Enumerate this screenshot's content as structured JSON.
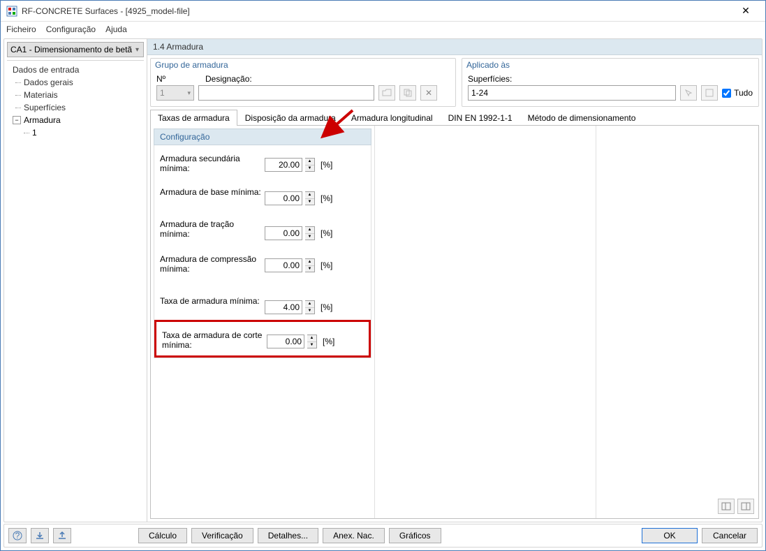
{
  "titlebar": {
    "title": "RF-CONCRETE Surfaces - [4925_model-file]"
  },
  "menu": {
    "file": "Ficheiro",
    "config": "Configuração",
    "help": "Ajuda"
  },
  "combo": "CA1 - Dimensionamento de betã",
  "tree": {
    "root": "Dados de entrada",
    "items": [
      "Dados gerais",
      "Materiais",
      "Superfícies"
    ],
    "parent": "Armadura",
    "sub": "1"
  },
  "section": "1.4 Armadura",
  "group1": {
    "title": "Grupo de armadura",
    "no": "Nº",
    "design": "Designação:",
    "no_val": "1",
    "design_val": ""
  },
  "group2": {
    "title": "Aplicado às",
    "surf": "Superfícies:",
    "surf_val": "1-24",
    "all": "Tudo"
  },
  "tabs": [
    "Taxas de armadura",
    "Disposição da armadura",
    "Armadura longitudinal",
    "DIN EN 1992-1-1",
    "Método de dimensionamento"
  ],
  "config": {
    "header": "Configuração",
    "rows": [
      {
        "label": "Armadura secundária mínima:",
        "value": "20.00",
        "unit": "[%]"
      },
      {
        "label": "Armadura de base mínima:",
        "value": "0.00",
        "unit": "[%]"
      },
      {
        "label": "Armadura de tração mínima:",
        "value": "0.00",
        "unit": "[%]"
      },
      {
        "label": "Armadura de compressão mínima:",
        "value": "0.00",
        "unit": "[%]"
      },
      {
        "label": "Taxa de armadura mínima:",
        "value": "4.00",
        "unit": "[%]"
      },
      {
        "label": "Taxa de armadura de corte mínima:",
        "value": "0.00",
        "unit": "[%]"
      }
    ]
  },
  "footer": {
    "calc": "Cálculo",
    "verify": "Verificação",
    "details": "Detalhes...",
    "anex": "Anex. Nac.",
    "graph": "Gráficos",
    "ok": "OK",
    "cancel": "Cancelar"
  }
}
